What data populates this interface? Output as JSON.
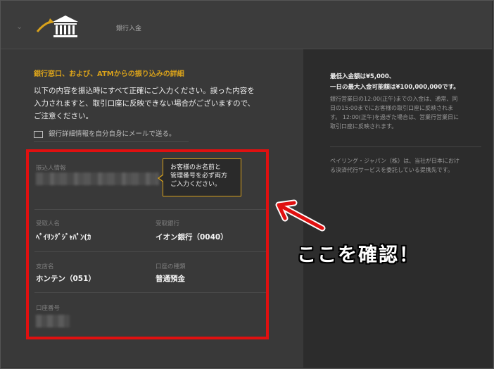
{
  "header": {
    "title": "銀行入金",
    "icons": [
      "chevron-down-icon",
      "bank-deposit-icon"
    ]
  },
  "main": {
    "section_title": "銀行窓口、および、ATMからの振り込みの詳細",
    "intro_line1": "以下の内容を振込時にすべて正確にご入力ください。誤った内容を",
    "intro_line2": "入力されますと、取引口座に反映できない場合がございますので、",
    "intro_line3": "ご注意ください。",
    "email_link": "銀行詳細情報を自分自身にメールで送る。",
    "fields": {
      "remitter_label": "振込人情報",
      "payee_label": "受取人名",
      "payee_value": "ﾍﾟｲﾘﾝｸﾞｼﾞｬﾊﾟﾝ(ｶ",
      "bank_label": "受取銀行",
      "bank_value": "イオン銀行（0040）",
      "branch_label": "支店名",
      "branch_value": "ホンテン（051）",
      "account_type_label": "口座の種類",
      "account_type_value": "普通預金",
      "account_number_label": "口座番号"
    },
    "tooltip": {
      "line1": "お客様のお名前と",
      "line2": "管理番号を必ず両方",
      "line3": "ご入力ください。"
    }
  },
  "sidebar": {
    "min_deposit": "最低入金額は¥5,000、",
    "max_deposit": "一日の最大入金可能額は¥100,000,000です。",
    "note_line1": "銀行営業日の12:00(正午)までの入金は、通常、同",
    "note_line2": "日の15:00までにお客様の取引口座に反映されま",
    "note_line3": "す。 12:00(正午)を過ぎた場合は、営業行営業日に",
    "note_line4": "取引口座に反映されます。",
    "company_line1": "ペイリング・ジャパン（株）は、当社が日本におけ",
    "company_line2": "る決済代行サービスを委託している提携先です。"
  },
  "annotation": {
    "callout": "ここを確認！",
    "highlight_color": "#e01010"
  },
  "colors": {
    "accent": "#d9a21b",
    "background": "#393939"
  }
}
